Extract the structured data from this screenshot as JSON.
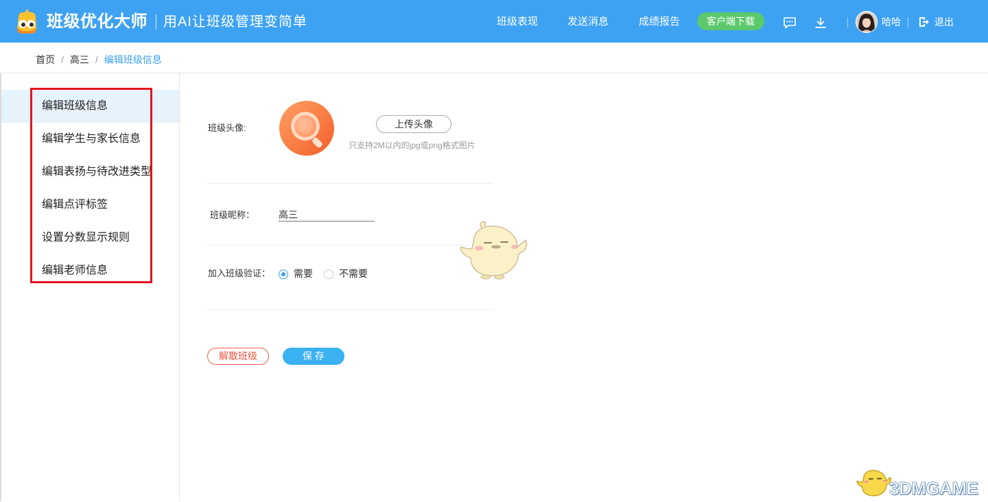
{
  "app": {
    "title": "班级优化大师",
    "slogan": "用AI让班级管理变简单",
    "logo_icon": "mascot-logo-icon"
  },
  "header": {
    "nav": [
      {
        "label": "班级表现"
      },
      {
        "label": "发送消息"
      },
      {
        "label": "成绩报告"
      }
    ],
    "download_button": "客户端下载",
    "message_icon": "chat-bubble-icon",
    "download_icon": "download-icon",
    "user_avatar": "user-avatar-photo",
    "user_name": "哈哈",
    "logout_icon": "logout-icon",
    "logout_label": "退出"
  },
  "breadcrumb": {
    "separator": "/",
    "items": [
      {
        "label": "首页",
        "current": false
      },
      {
        "label": "高三",
        "current": false
      },
      {
        "label": "编辑班级信息",
        "current": true
      }
    ]
  },
  "sidebar": {
    "items": [
      {
        "label": "编辑班级信息",
        "active": true
      },
      {
        "label": "编辑学生与家长信息",
        "active": false
      },
      {
        "label": "编辑表扬与待改进类型",
        "active": false
      },
      {
        "label": "编辑点评标签",
        "active": false
      },
      {
        "label": "设置分数显示规则",
        "active": false
      },
      {
        "label": "编辑老师信息",
        "active": false
      }
    ]
  },
  "form": {
    "avatar": {
      "label": "班级头像:",
      "image_icon": "magnifier-class-avatar",
      "upload_button": "上传头像",
      "hint": "只支持2M以内的jpg或png格式图片"
    },
    "nickname": {
      "label": "班级昵称：",
      "value": "高三"
    },
    "verification": {
      "label": "加入班级验证：",
      "options": [
        {
          "label": "需要",
          "selected": true
        },
        {
          "label": "不需要",
          "selected": false
        }
      ]
    },
    "dismiss_button": "解散班级",
    "save_button": "保 存"
  },
  "decoration": {
    "mascot_icon": "chick-mascot-illustration"
  },
  "watermark": {
    "text": "3DMGAME",
    "icon": "chick-mascot-icon"
  },
  "colors": {
    "header_bg": "#3ea2f3",
    "accent": "#3aa0f0",
    "download_button": "#5cc96c",
    "danger": "#f0553f",
    "sidebar_active_bg": "#e6f2fc",
    "annotation_box": "#e3141c"
  }
}
